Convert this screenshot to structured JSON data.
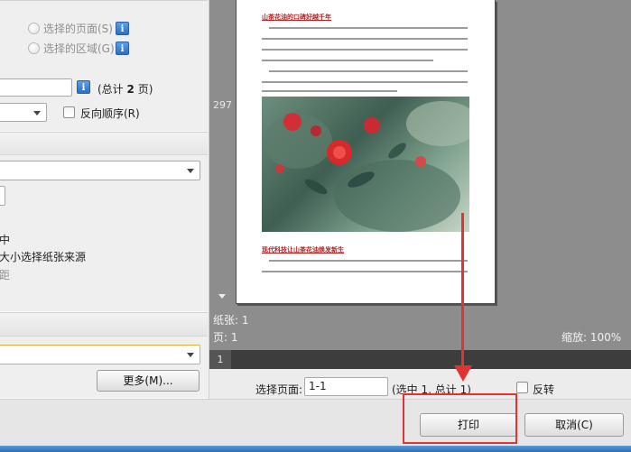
{
  "print_range": {
    "selected_pages_label": "选择的页面(S)",
    "selected_pages_mnemonic": "S",
    "selected_area_label": "选择的区域(G)",
    "selected_area_mnemonic": "G",
    "total_pages_prefix": "(总计",
    "total_pages_count": "2",
    "total_pages_suffix": "页)",
    "reverse_order_label": "反向顺序(R)",
    "reverse_order_mnemonic": "R"
  },
  "paper": {
    "partial_text": "中",
    "select_paper_source_label": "大小选择纸张来源",
    "distance_label": "距"
  },
  "more_button_label": "更多(M)...",
  "preview": {
    "page_number": "297",
    "paper_count_label": "纸张: 1",
    "page_label": "页: 1",
    "zoom_label": "缩放: 100%",
    "thumbnail_page": "1",
    "doc_heading_1": "山茶花油的口碑好越千年",
    "doc_heading_2": "现代科技让山茶花油焕发新生"
  },
  "select_page": {
    "label": "选择页面:",
    "value": "1-1",
    "summary": "(选中 1, 总计 1)",
    "invert_label": "反转"
  },
  "footer": {
    "print_button": "打印",
    "cancel_button": "取消(C)"
  },
  "colors": {
    "annotation_red": "#e03333",
    "info_blue": "#2b6fc6",
    "preview_bg": "#8d8d8d"
  }
}
